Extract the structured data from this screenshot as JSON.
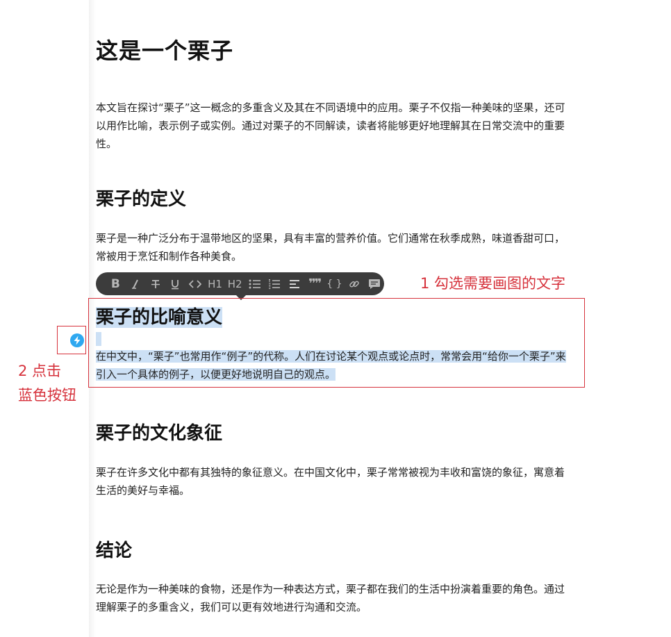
{
  "document": {
    "title": "这是一个栗子",
    "intro": "本文旨在探讨“栗子”这一概念的多重含义及其在不同语境中的应用。栗子不仅指一种美味的坚果，还可以用作比喻，表示例子或实例。通过对栗子的不同解读，读者将能够更好地理解其在日常交流中的重要性。",
    "sections": [
      {
        "heading": "栗子的定义",
        "body": "栗子是一种广泛分布于温带地区的坚果，具有丰富的营养价值。它们通常在秋季成熟，味道香甜可口，常被用于烹饪和制作各种美食。"
      },
      {
        "heading": "栗子的比喻意义",
        "body": "在中文中，“栗子”也常用作“例子”的代称。人们在讨论某个观点或论点时，常常会用“给你一个栗子”来引入一个具体的例子，以便更好地说明自己的观点。"
      },
      {
        "heading": "栗子的文化象征",
        "body": "栗子在许多文化中都有其独特的象征意义。在中国文化中，栗子常常被视为丰收和富饶的象征，寓意着生活的美好与幸福。"
      },
      {
        "heading": "结论",
        "body": "无论是作为一种美味的食物，还是作为一种表达方式，栗子都在我们的生活中扮演着重要的角色。通过理解栗子的多重含义，我们可以更有效地进行沟通和交流。"
      }
    ]
  },
  "toolbar": {
    "buttons": [
      {
        "name": "bold-icon",
        "glyph": "B"
      },
      {
        "name": "italic-icon",
        "glyph": "𝘐"
      },
      {
        "name": "strikethrough-icon",
        "glyph": "S̶"
      },
      {
        "name": "underline-icon",
        "glyph": "U̲"
      },
      {
        "name": "code-icon",
        "glyph": "<>"
      },
      {
        "name": "heading1-icon",
        "glyph": "H1"
      },
      {
        "name": "heading2-icon",
        "glyph": "H2"
      },
      {
        "name": "bullet-list-icon",
        "glyph": "☰"
      },
      {
        "name": "numbered-list-icon",
        "glyph": "☷"
      },
      {
        "name": "align-icon",
        "glyph": "≡"
      },
      {
        "name": "quote-icon",
        "glyph": "❞"
      },
      {
        "name": "code-block-icon",
        "glyph": "{}"
      },
      {
        "name": "link-icon",
        "glyph": "🔗"
      },
      {
        "name": "comment-icon",
        "glyph": "💬"
      }
    ]
  },
  "annotations": {
    "step1": "1 勾选需要画图的文字",
    "step2_line1": "2 点击",
    "step2_line2": "蓝色按钮",
    "color": "#d6313b"
  },
  "colors": {
    "selection": "#cce0f5",
    "toolbar_bg": "#3c3c3c",
    "ai_button": "#2fa8f0"
  }
}
